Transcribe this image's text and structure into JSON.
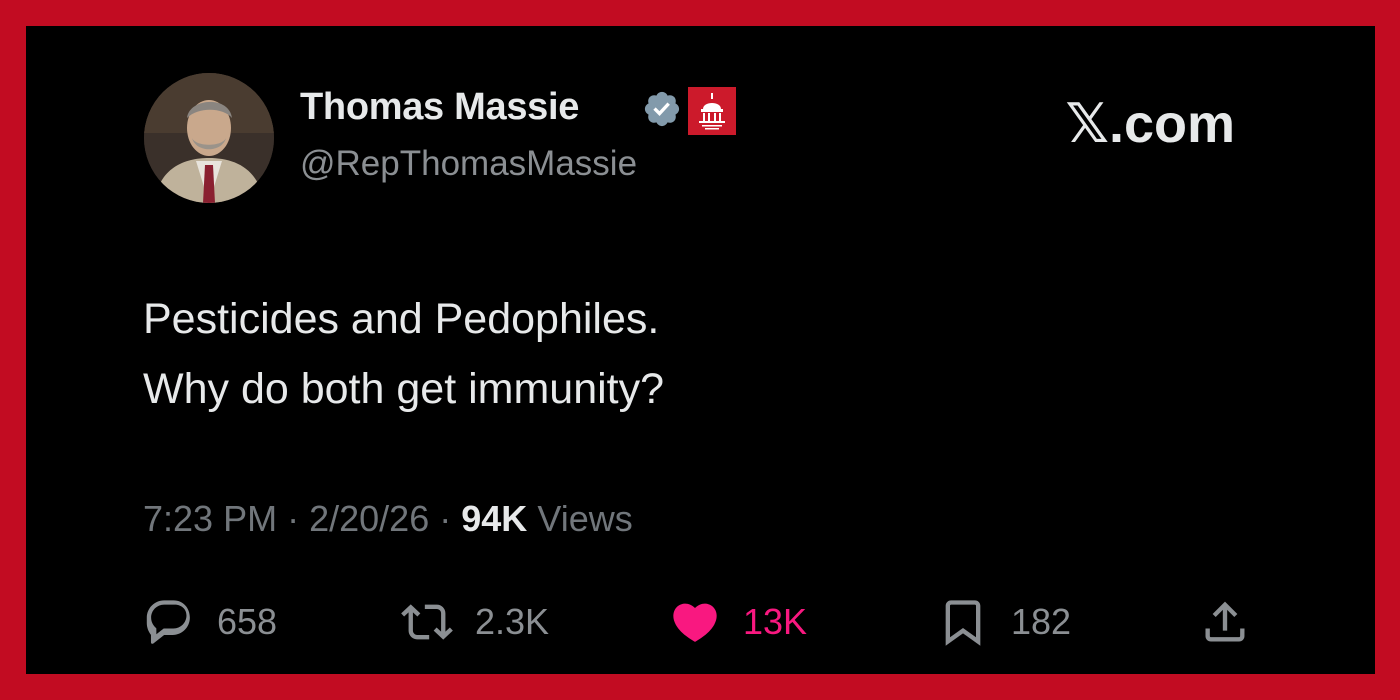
{
  "author": {
    "name": "Thomas Massie",
    "handle": "@RepThomasMassie"
  },
  "brand": "𝕏.com",
  "tweet": {
    "lines": [
      "Pesticides and Pedophiles.",
      "Why do both get immunity?"
    ]
  },
  "meta": {
    "time": "7:23 PM",
    "date": "2/20/26",
    "views_count": "94K",
    "views_label": "Views",
    "separator": "·"
  },
  "actions": {
    "replies": "658",
    "reposts": "2.3K",
    "likes": "13K",
    "bookmarks": "182"
  },
  "icons": {
    "verified": "verified-badge-icon",
    "affiliation": "house-gop-capitol-icon",
    "reply": "reply-icon",
    "repost": "repost-icon",
    "like": "heart-icon",
    "bookmark": "bookmark-icon",
    "share": "share-icon"
  },
  "colors": {
    "frame": "#c20c22",
    "background": "#000000",
    "text_primary": "#e7e9ea",
    "text_secondary": "#71767b",
    "verified": "#829aab",
    "like": "#f91880",
    "affiliation_badge": "#cc1a2b"
  }
}
